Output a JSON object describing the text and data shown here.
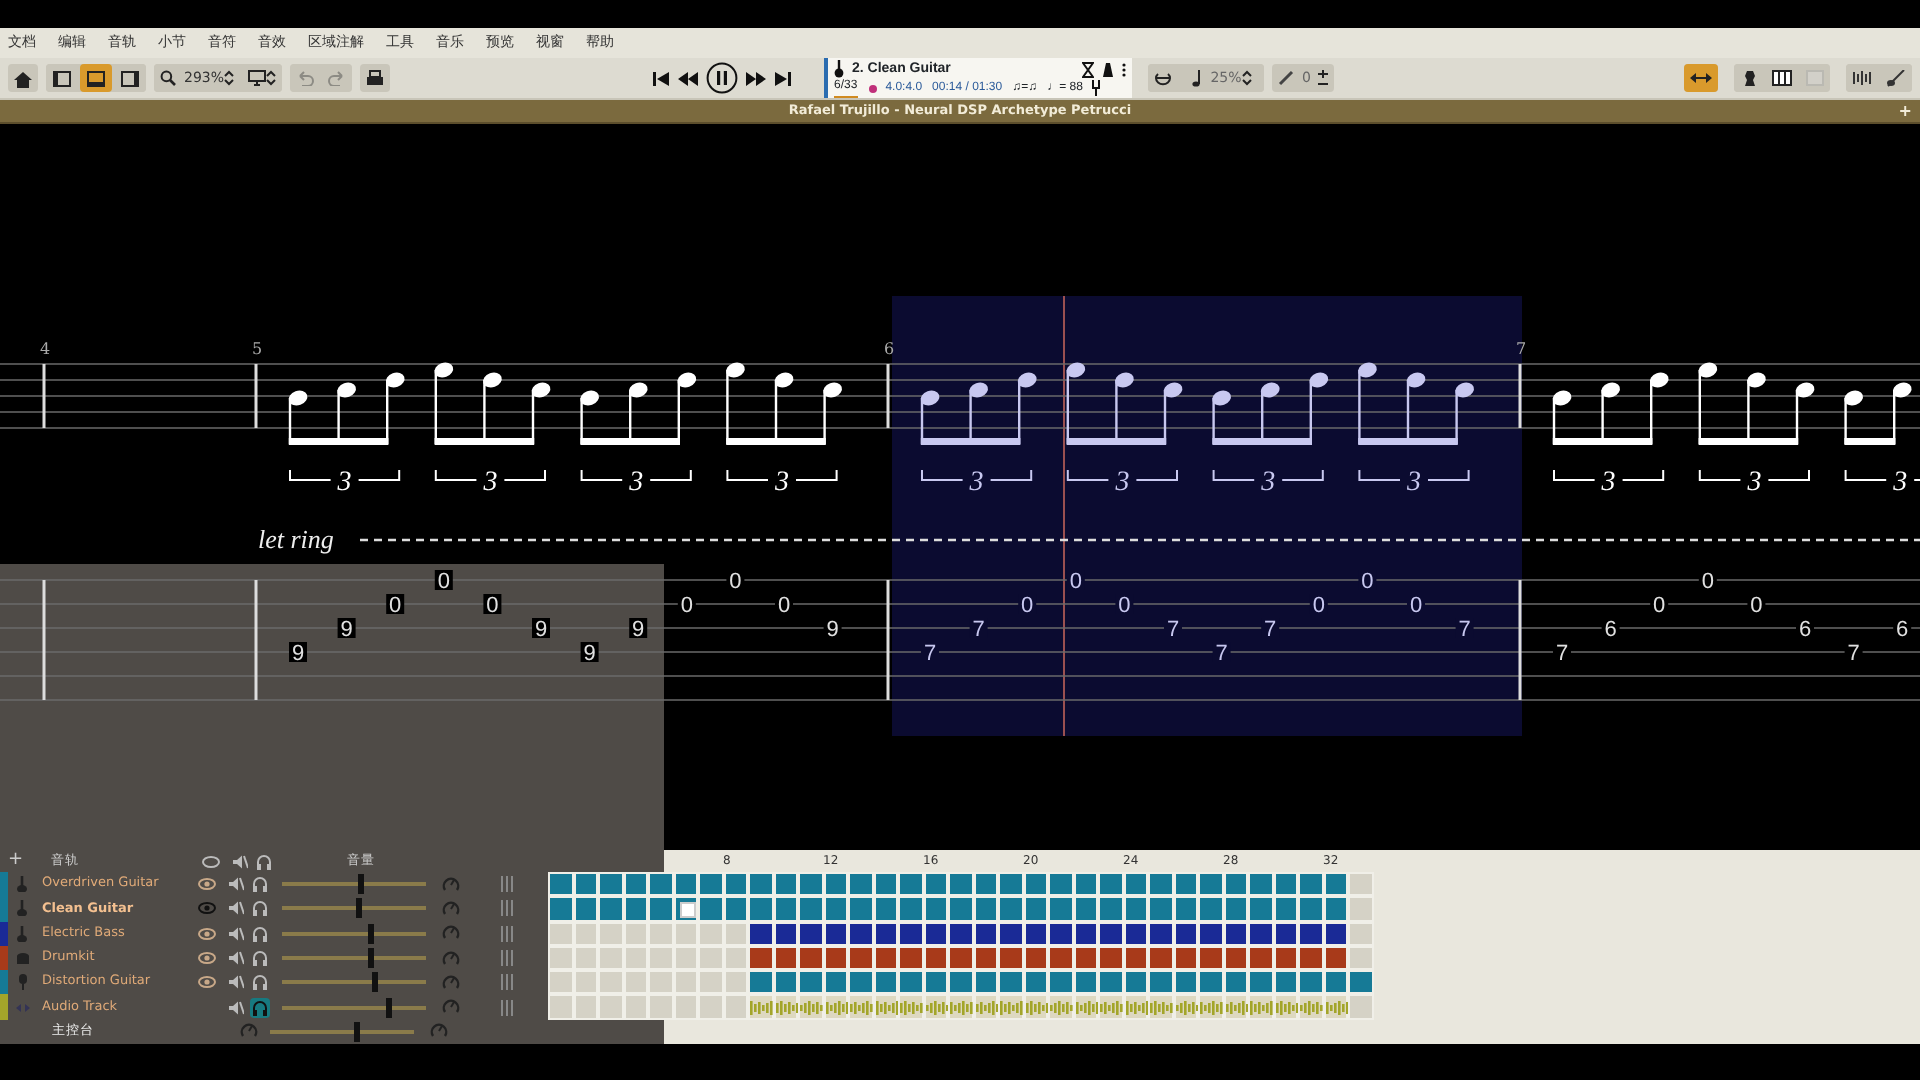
{
  "menu": [
    "文档",
    "编辑",
    "音轨",
    "小节",
    "音符",
    "音效",
    "区域注解",
    "工具",
    "音乐",
    "预览",
    "视窗",
    "帮助"
  ],
  "toolbar": {
    "views": [
      {
        "selected": false
      },
      {
        "selected": true
      },
      {
        "selected": false
      }
    ],
    "zoom": "293%",
    "history": [
      {
        "disabled": true
      },
      {
        "disabled": true
      }
    ],
    "speed": "25%",
    "transpose": "0",
    "right_tools": [
      {
        "selected": true,
        "disabled": false
      },
      {
        "selected": false,
        "disabled": false
      },
      {
        "selected": false,
        "disabled": false
      },
      {
        "selected": false,
        "disabled": true
      },
      {
        "selected": false,
        "disabled": false
      },
      {
        "selected": false,
        "disabled": false
      }
    ]
  },
  "song_panel": {
    "track_title": "2. Clean Guitar",
    "bar": "6/33",
    "signature": "4.0:4.0",
    "time": "00:14 / 01:30",
    "swing": "♫=♫",
    "tempo": "♩= 88"
  },
  "score_title": "Rafael Trujillo - Neural DSP Archetype Petrucci",
  "add_tab": "+",
  "score": {
    "let_ring": "let ring",
    "measures": [
      {
        "number": "4",
        "selected": false
      },
      {
        "number": "5",
        "selected": false,
        "tuplets": [
          "3",
          "3",
          "3",
          "3"
        ],
        "notes": [
          {
            "fret": "9",
            "kind": "fourth"
          },
          {
            "fret": "9",
            "kind": "third"
          },
          {
            "fret": "0",
            "kind": "second"
          },
          {
            "fret": "0",
            "kind": "first"
          },
          {
            "fret": "0",
            "kind": "second"
          },
          {
            "fret": "9",
            "kind": "third"
          },
          {
            "fret": "9",
            "kind": "fourth"
          },
          {
            "fret": "9",
            "kind": "third"
          },
          {
            "fret": "0",
            "kind": "second"
          },
          {
            "fret": "0",
            "kind": "first"
          },
          {
            "fret": "0",
            "kind": "second"
          },
          {
            "fret": "9",
            "kind": "third"
          }
        ]
      },
      {
        "number": "6",
        "selected": true,
        "tuplets": [
          "3",
          "3",
          "3",
          "3"
        ],
        "notes": [
          {
            "fret": "7",
            "kind": "fourth"
          },
          {
            "fret": "7",
            "kind": "third"
          },
          {
            "fret": "0",
            "kind": "second"
          },
          {
            "fret": "0",
            "kind": "first"
          },
          {
            "fret": "0",
            "kind": "second"
          },
          {
            "fret": "7",
            "kind": "third"
          },
          {
            "fret": "7",
            "kind": "fourth"
          },
          {
            "fret": "7",
            "kind": "third"
          },
          {
            "fret": "0",
            "kind": "second"
          },
          {
            "fret": "0",
            "kind": "first"
          },
          {
            "fret": "0",
            "kind": "second"
          },
          {
            "fret": "7",
            "kind": "third"
          }
        ]
      },
      {
        "number": "7",
        "selected": false,
        "tuplets": [
          "3",
          "3",
          "3"
        ],
        "notes": [
          {
            "fret": "7",
            "kind": "fourth"
          },
          {
            "fret": "6",
            "kind": "third"
          },
          {
            "fret": "0",
            "kind": "second"
          },
          {
            "fret": "0",
            "kind": "first"
          },
          {
            "fret": "0",
            "kind": "second"
          },
          {
            "fret": "6",
            "kind": "third"
          },
          {
            "fret": "7",
            "kind": "fourth"
          },
          {
            "fret": "6",
            "kind": "third"
          }
        ]
      }
    ]
  },
  "tracks": {
    "add": "+",
    "header": "音轨",
    "volume_header": "音量",
    "master": {
      "name": "主控台",
      "level": 0.6
    },
    "ruler": [
      "8",
      "12",
      "16",
      "20",
      "24",
      "28",
      "32"
    ],
    "items": [
      {
        "name": "Overdriven Guitar",
        "kind": "guitar",
        "color": "#167a96",
        "selected": false,
        "visible": false,
        "solo": false,
        "level": 0.55,
        "bars": [
          true,
          true,
          true,
          true,
          true,
          true,
          true,
          true,
          true,
          true,
          true,
          true,
          true,
          true,
          true,
          true,
          true,
          true,
          true,
          true,
          true,
          true,
          true,
          true,
          true,
          true,
          true,
          true,
          true,
          true,
          true,
          true,
          false
        ]
      },
      {
        "name": "Clean Guitar",
        "kind": "guitar",
        "color": "#167a96",
        "selected": true,
        "visible": true,
        "solo": false,
        "level": 0.53,
        "bars": [
          true,
          true,
          true,
          true,
          true,
          true,
          true,
          true,
          true,
          true,
          true,
          true,
          true,
          true,
          true,
          true,
          true,
          true,
          true,
          true,
          true,
          true,
          true,
          true,
          true,
          true,
          true,
          true,
          true,
          true,
          true,
          true,
          false
        ]
      },
      {
        "name": "Electric Bass",
        "kind": "guitar",
        "color": "#1a2a96",
        "selected": false,
        "visible": false,
        "solo": false,
        "level": 0.62,
        "bars": [
          false,
          false,
          false,
          false,
          false,
          false,
          false,
          false,
          true,
          true,
          true,
          true,
          true,
          true,
          true,
          true,
          true,
          true,
          true,
          true,
          true,
          true,
          true,
          true,
          true,
          true,
          true,
          true,
          true,
          true,
          true,
          true,
          false
        ]
      },
      {
        "name": "Drumkit",
        "kind": "drums",
        "color": "#a83a1a",
        "selected": false,
        "visible": false,
        "solo": false,
        "level": 0.62,
        "bars": [
          false,
          false,
          false,
          false,
          false,
          false,
          false,
          false,
          true,
          true,
          true,
          true,
          true,
          true,
          true,
          true,
          true,
          true,
          true,
          true,
          true,
          true,
          true,
          true,
          true,
          true,
          true,
          true,
          true,
          true,
          true,
          true,
          false
        ]
      },
      {
        "name": "Distortion Guitar",
        "kind": "microphone",
        "color": "#167a96",
        "selected": false,
        "visible": false,
        "solo": false,
        "level": 0.64,
        "bars": [
          false,
          false,
          false,
          false,
          false,
          false,
          false,
          false,
          true,
          true,
          true,
          true,
          true,
          true,
          true,
          true,
          true,
          true,
          true,
          true,
          true,
          true,
          true,
          true,
          true,
          true,
          true,
          true,
          true,
          true,
          true,
          true,
          true
        ]
      },
      {
        "name": "Audio Track",
        "kind": "audio",
        "color": "#a3a52a",
        "selected": false,
        "solo": true,
        "level": 0.74,
        "bars": [
          false,
          false,
          false,
          false,
          false,
          false,
          false,
          false,
          true,
          true,
          true,
          true,
          true,
          true,
          true,
          true,
          true,
          true,
          true,
          true,
          true,
          true,
          true,
          true,
          true,
          true,
          true,
          true,
          true,
          true,
          true,
          true,
          false
        ]
      }
    ]
  }
}
